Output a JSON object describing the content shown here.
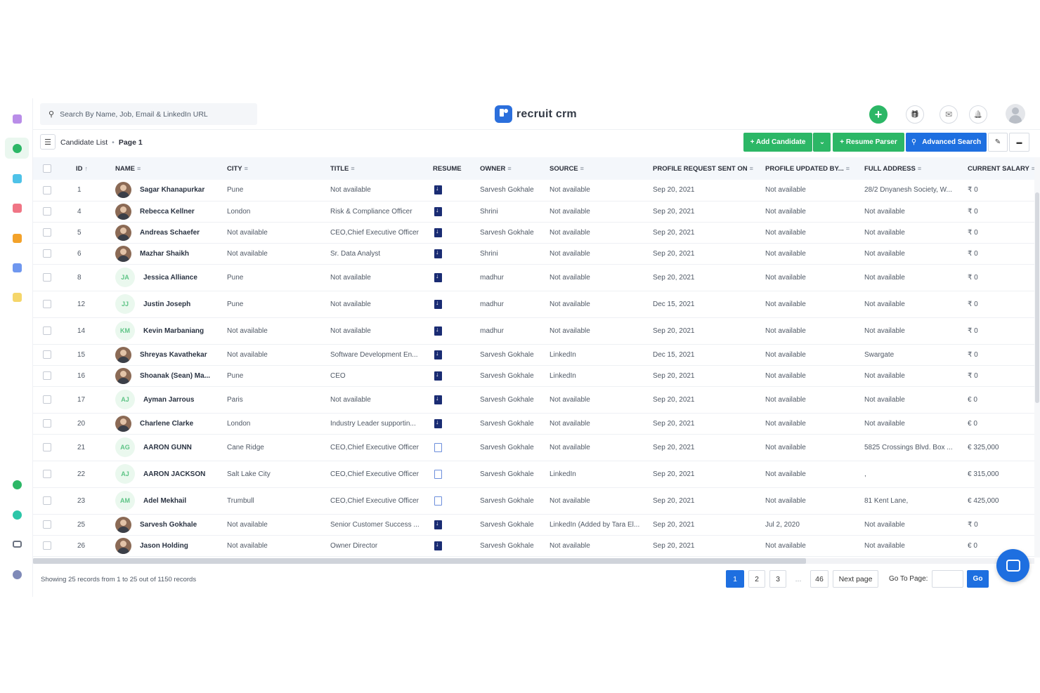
{
  "search": {
    "placeholder": "Search By Name, Job, Email & LinkedIn URL"
  },
  "brand": {
    "name": "recruit crm"
  },
  "breadcrumb": {
    "list": "Candidate List",
    "page": "Page 1"
  },
  "toolbar": {
    "add_candidate": "+  Add Candidate",
    "add_dropdown": "⌄",
    "resume_parser": "+  Resume Parser",
    "advanced_search": "Advanced Search",
    "edit_icon": "✎",
    "view_icon": "▬"
  },
  "topbar_icons": {
    "plus": "+",
    "gift": "🎁",
    "mail": "✉",
    "bell": "🔔"
  },
  "sidebar_icons": [
    "reports-icon",
    "candidates-icon",
    "companies-icon",
    "contacts-icon",
    "jobs-icon",
    "email-icon",
    "tasks-icon",
    "billing-icon",
    "analytics-icon",
    "cards-icon",
    "settings-icon"
  ],
  "colors": {
    "green": "#2cb766",
    "blue": "#1e6fe0",
    "navy": "#1a2c73"
  },
  "table": {
    "headers": [
      "ID",
      "NAME",
      "CITY",
      "TITLE",
      "RESUME",
      "OWNER",
      "SOURCE",
      "PROFILE REQUEST SENT ON",
      "PROFILE UPDATED BY...",
      "FULL ADDRESS",
      "CURRENT SALARY"
    ],
    "rows": [
      {
        "id": "1",
        "name": "Sagar Khanapurkar",
        "avatar": "photo",
        "city": "Pune",
        "title": "Not available",
        "resume": "filled",
        "owner": "Sarvesh Gokhale",
        "source": "Not available",
        "sent": "Sep 20, 2021",
        "updated": "Not available",
        "address": "28/2 Dnyanesh Society, W...",
        "salary": "₹ 0"
      },
      {
        "id": "4",
        "name": "Rebecca Kellner",
        "avatar": "photo",
        "city": "London",
        "title": "Risk & Compliance Officer",
        "resume": "filled",
        "owner": "Shrini",
        "source": "Not available",
        "sent": "Sep 20, 2021",
        "updated": "Not available",
        "address": "Not available",
        "salary": "₹ 0"
      },
      {
        "id": "5",
        "name": "Andreas Schaefer",
        "avatar": "photo",
        "city": "Not available",
        "title": "CEO,Chief Executive Officer",
        "resume": "filled",
        "owner": "Sarvesh Gokhale",
        "source": "Not available",
        "sent": "Sep 20, 2021",
        "updated": "Not available",
        "address": "Not available",
        "salary": "₹ 0"
      },
      {
        "id": "6",
        "name": "Mazhar Shaikh",
        "avatar": "photo",
        "city": "Not available",
        "title": "Sr. Data Analyst",
        "resume": "filled",
        "owner": "Shrini",
        "source": "Not available",
        "sent": "Sep 20, 2021",
        "updated": "Not available",
        "address": "Not available",
        "salary": "₹ 0"
      },
      {
        "id": "8",
        "name": "Jessica Alliance",
        "avatar": "JA",
        "city": "Pune",
        "title": "Not available",
        "resume": "filled",
        "owner": "madhur",
        "source": "Not available",
        "sent": "Sep 20, 2021",
        "updated": "Not available",
        "address": "Not available",
        "salary": "₹ 0"
      },
      {
        "id": "12",
        "name": "Justin Joseph",
        "avatar": "JJ",
        "city": "Pune",
        "title": "Not available",
        "resume": "filled",
        "owner": "madhur",
        "source": "Not available",
        "sent": "Dec 15, 2021",
        "updated": "Not available",
        "address": "Not available",
        "salary": "₹ 0"
      },
      {
        "id": "14",
        "name": "Kevin Marbaniang",
        "avatar": "KM",
        "city": "Not available",
        "title": "Not available",
        "resume": "filled",
        "owner": "madhur",
        "source": "Not available",
        "sent": "Sep 20, 2021",
        "updated": "Not available",
        "address": "Not available",
        "salary": "₹ 0"
      },
      {
        "id": "15",
        "name": "Shreyas Kavathekar",
        "avatar": "photo",
        "city": "Not available",
        "title": "Software Development En...",
        "resume": "filled",
        "owner": "Sarvesh Gokhale",
        "source": "LinkedIn",
        "sent": "Dec 15, 2021",
        "updated": "Not available",
        "address": "Swargate",
        "salary": "₹ 0"
      },
      {
        "id": "16",
        "name": "Shoanak (Sean) Ma...",
        "avatar": "photo",
        "city": "Pune",
        "title": "CEO",
        "resume": "filled",
        "owner": "Sarvesh Gokhale",
        "source": "LinkedIn",
        "sent": "Sep 20, 2021",
        "updated": "Not available",
        "address": "Not available",
        "salary": "₹ 0"
      },
      {
        "id": "17",
        "name": "Ayman Jarrous",
        "avatar": "AJ",
        "city": "Paris",
        "title": "Not available",
        "resume": "filled",
        "owner": "Sarvesh Gokhale",
        "source": "Not available",
        "sent": "Sep 20, 2021",
        "updated": "Not available",
        "address": "Not available",
        "salary": "€ 0"
      },
      {
        "id": "20",
        "name": "Charlene Clarke",
        "avatar": "photo",
        "city": "London",
        "title": "Industry Leader supportin...",
        "resume": "filled",
        "owner": "Sarvesh Gokhale",
        "source": "Not available",
        "sent": "Sep 20, 2021",
        "updated": "Not available",
        "address": "Not available",
        "salary": "€ 0"
      },
      {
        "id": "21",
        "name": "AARON GUNN",
        "avatar": "AG",
        "city": "Cane Ridge",
        "title": "CEO,Chief Executive Officer",
        "resume": "empty",
        "owner": "Sarvesh Gokhale",
        "source": "Not available",
        "sent": "Sep 20, 2021",
        "updated": "Not available",
        "address": "5825 Crossings Blvd. Box ...",
        "salary": "€ 325,000"
      },
      {
        "id": "22",
        "name": "AARON JACKSON",
        "avatar": "AJ",
        "city": "Salt Lake City",
        "title": "CEO,Chief Executive Officer",
        "resume": "empty",
        "owner": "Sarvesh Gokhale",
        "source": "LinkedIn",
        "sent": "Sep 20, 2021",
        "updated": "Not available",
        "address": ",",
        "salary": "€ 315,000"
      },
      {
        "id": "23",
        "name": "Adel Mekhail",
        "avatar": "AM",
        "city": "Trumbull",
        "title": "CEO,Chief Executive Officer",
        "resume": "empty",
        "owner": "Sarvesh Gokhale",
        "source": "Not available",
        "sent": "Sep 20, 2021",
        "updated": "Not available",
        "address": "81 Kent Lane,",
        "salary": "€ 425,000"
      },
      {
        "id": "25",
        "name": "Sarvesh Gokhale",
        "avatar": "photo",
        "city": "Not available",
        "title": "Senior Customer Success ...",
        "resume": "filled",
        "owner": "Sarvesh Gokhale",
        "source": "LinkedIn (Added by Tara El...",
        "sent": "Sep 20, 2021",
        "updated": "Jul 2, 2020",
        "address": "Not available",
        "salary": "₹ 0"
      },
      {
        "id": "26",
        "name": "Jason Holding",
        "avatar": "photo",
        "city": "Not available",
        "title": "Owner Director",
        "resume": "filled",
        "owner": "Sarvesh Gokhale",
        "source": "Not available",
        "sent": "Sep 20, 2021",
        "updated": "Not available",
        "address": "Not available",
        "salary": "€ 0"
      }
    ]
  },
  "footer": {
    "summary": "Showing 25 records from 1 to 25 out of 1150 records",
    "pages": [
      "1",
      "2",
      "3",
      "...",
      "46"
    ],
    "next": "Next page",
    "goto_label": "Go To Page:",
    "go": "Go"
  }
}
